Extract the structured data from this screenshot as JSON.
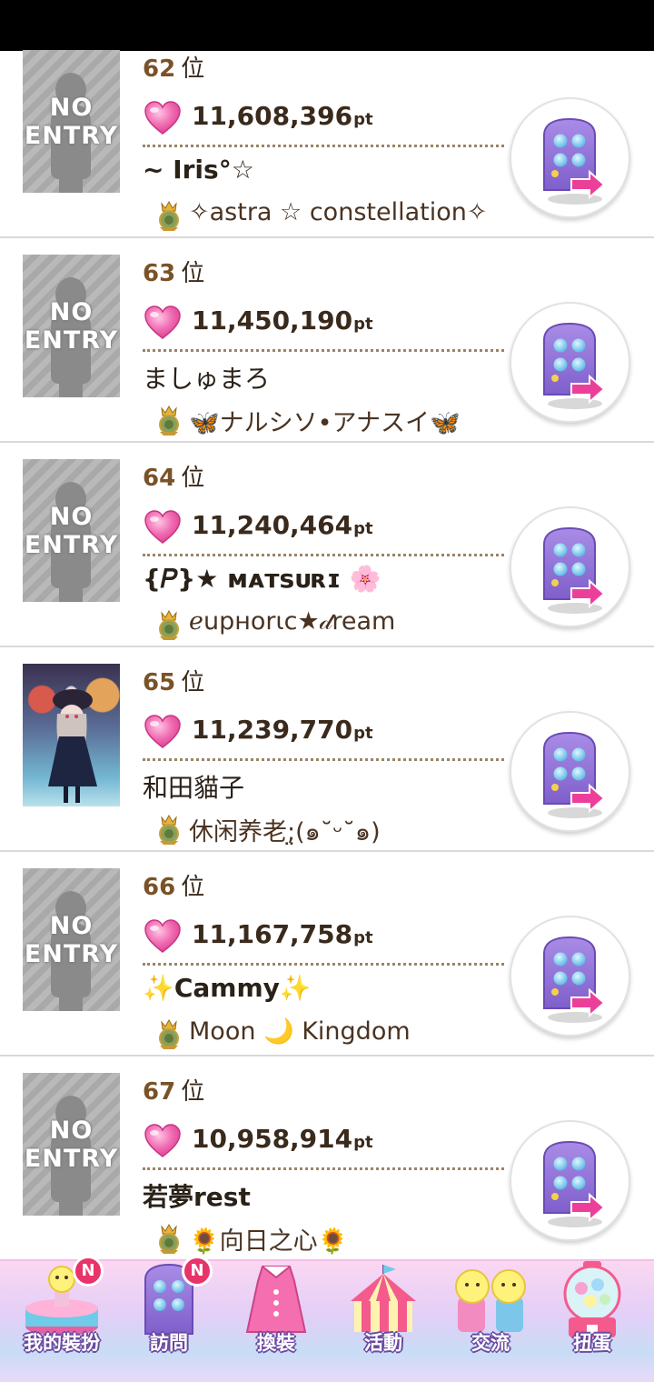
{
  "rows": [
    {
      "rank": "62",
      "rank_suffix": "位",
      "avatar_text": "NO\nENTRY",
      "points": "11,608,396",
      "unit": "pt",
      "name": "~ Iris°☆",
      "group": "✧astra ☆ constellation✧"
    },
    {
      "rank": "63",
      "rank_suffix": "位",
      "avatar_text": "NO\nENTRY",
      "points": "11,450,190",
      "unit": "pt",
      "name": "ましゅまろ",
      "group": "🦋ナルシソ•アナスイ🦋"
    },
    {
      "rank": "64",
      "rank_suffix": "位",
      "avatar_text": "NO\nENTRY",
      "points": "11,240,464",
      "unit": "pt",
      "name": "{𝑃}★ ᴍᴀᴛsᴜʀɪ 🌸",
      "group": "ℯupнorιc★𝒹ream"
    },
    {
      "rank": "65",
      "rank_suffix": "位",
      "avatar_text": "",
      "points": "11,239,770",
      "unit": "pt",
      "name": "和田貓子",
      "group": "休闲养老;̤(๑˘ᵕ˘๑)"
    },
    {
      "rank": "66",
      "rank_suffix": "位",
      "avatar_text": "NO\nENTRY",
      "points": "11,167,758",
      "unit": "pt",
      "name": "✨Cammy✨",
      "group": "Moon 🌙 Kingdom"
    },
    {
      "rank": "67",
      "rank_suffix": "位",
      "avatar_text": "NO\nENTRY",
      "points": "10,958,914",
      "unit": "pt",
      "name": "若夢rest",
      "group": "🌻向日之心🌻"
    }
  ],
  "nav": [
    {
      "label": "我的裝扮",
      "badge": "N"
    },
    {
      "label": "訪問",
      "badge": "N"
    },
    {
      "label": "換裝",
      "badge": ""
    },
    {
      "label": "活動",
      "badge": ""
    },
    {
      "label": "交流",
      "badge": ""
    },
    {
      "label": "扭蛋",
      "badge": ""
    }
  ],
  "colors": {
    "rank_text": "#7a5228",
    "heart": "#ee5aa8",
    "visit_door": "#9a7bdc",
    "visit_arrow": "#ec3f9a",
    "nav_badge": "#e8336b"
  }
}
